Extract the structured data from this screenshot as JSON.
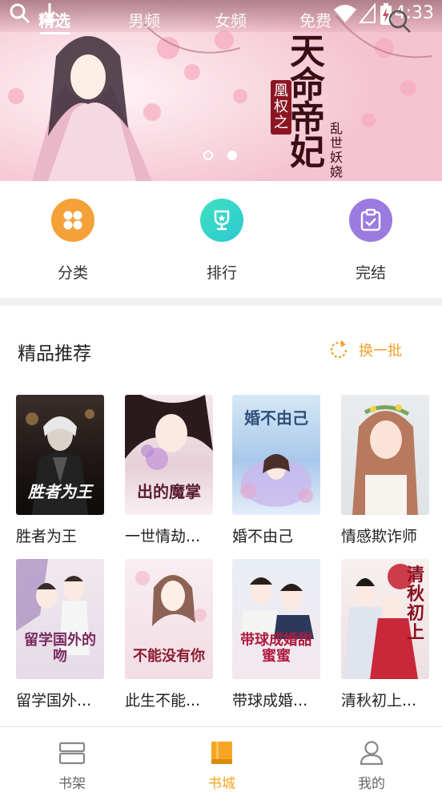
{
  "status": {
    "time": "4:33"
  },
  "nav": {
    "tabs": [
      {
        "label": "精选"
      },
      {
        "label": "男频"
      },
      {
        "label": "女频"
      },
      {
        "label": "免费"
      }
    ]
  },
  "banner": {
    "title_main": "天命帝妃",
    "title_sub": "凰权之",
    "author": "乱世妖娆"
  },
  "entries": [
    {
      "label": "分类"
    },
    {
      "label": "排行"
    },
    {
      "label": "完结"
    }
  ],
  "section": {
    "title": "精品推荐",
    "refresh_label": "换一批"
  },
  "books": [
    {
      "title": "胜者为王",
      "cover_text": "胜者为王"
    },
    {
      "title": "一世情劫...",
      "cover_text": "出的魔掌"
    },
    {
      "title": "婚不由己",
      "cover_text": "婚不由己"
    },
    {
      "title": "情感欺诈师",
      "cover_text": ""
    },
    {
      "title": "留学国外...",
      "cover_text": "留学国外的吻"
    },
    {
      "title": "此生不能...",
      "cover_text": "不能没有你"
    },
    {
      "title": "带球成婚...",
      "cover_text": "带球成婚甜蜜蜜"
    },
    {
      "title": "清秋初上...",
      "cover_text": "清秋初上"
    }
  ],
  "bottom_nav": [
    {
      "label": "书架"
    },
    {
      "label": "书城"
    },
    {
      "label": "我的"
    }
  ],
  "colors": {
    "accent": "#f5a623",
    "category": "#f5a13a",
    "rank": "#3dd6b8",
    "finished": "#9b7be0"
  }
}
